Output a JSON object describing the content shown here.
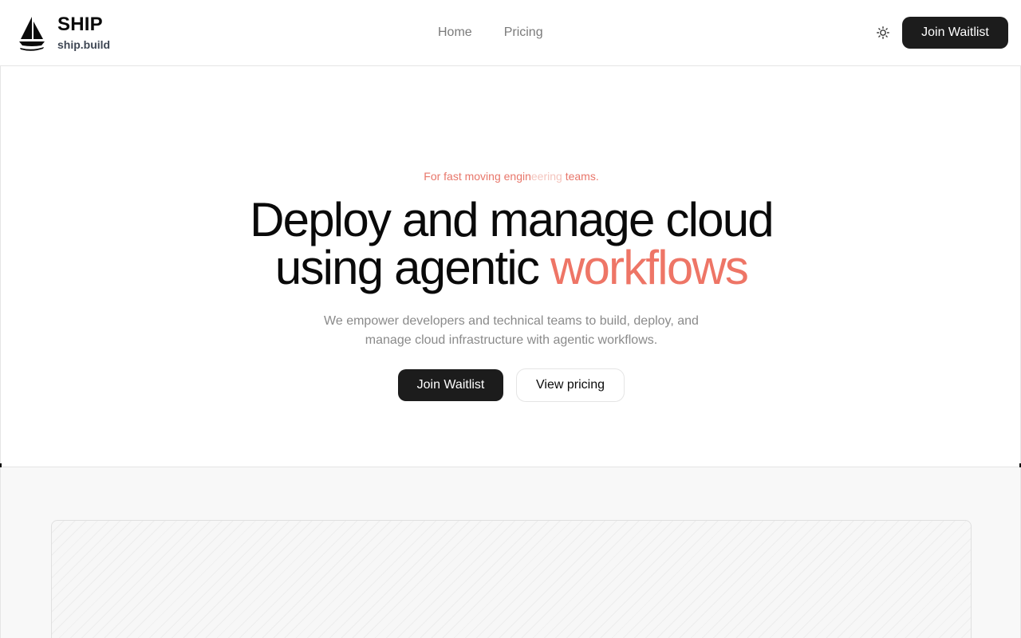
{
  "brand": {
    "name": "SHIP",
    "domain": "ship.build",
    "logo_icon": "sailboat-icon"
  },
  "nav": {
    "items": [
      {
        "label": "Home"
      },
      {
        "label": "Pricing"
      }
    ]
  },
  "header": {
    "theme_icon": "sun-icon",
    "cta_label": "Join Waitlist"
  },
  "hero": {
    "tagline_start": "For fast moving engin",
    "tagline_fade": "eering",
    "tagline_end": " teams.",
    "headline_line1": "Deploy and manage cloud",
    "headline_line2_start": "using agentic ",
    "headline_accent": "workflows",
    "subtext": "We empower developers and technical teams to build, deploy, and manage cloud infrastructure with agentic workflows.",
    "primary_cta": "Join Waitlist",
    "secondary_cta": "View pricing"
  },
  "colors": {
    "accent": "#ee7566",
    "button_dark": "#1c1c1c",
    "muted_text": "#8a8a8a"
  }
}
